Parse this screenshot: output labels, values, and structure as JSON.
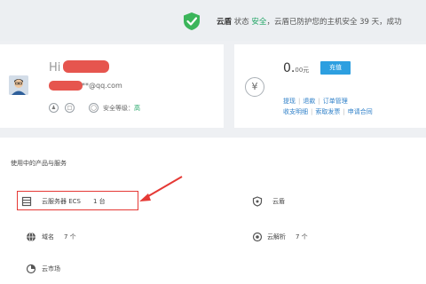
{
  "banner": {
    "brand": "云盾",
    "text_a": " 状态 ",
    "status": "安全",
    "text_b": "，云盾已防护您的主机安全 39 天，成功"
  },
  "user": {
    "greeting": "Hi",
    "email_suffix": "**@qq.com",
    "security_label": "安全等级：",
    "security_level": "高"
  },
  "account": {
    "balance_main": "0.",
    "balance_unit": "00元",
    "recharge_label": "充值",
    "links_row1": [
      "提现",
      "退款",
      "订单管理"
    ],
    "links_row2": [
      "收支明细",
      "索取发票",
      "申请合同"
    ]
  },
  "products": {
    "section_title": "使用中的产品与服务",
    "items": [
      {
        "label": "云服务器 ECS",
        "count": "1 台",
        "icon": "server-icon"
      },
      {
        "label": "云盾",
        "count": "",
        "icon": "shield-icon"
      },
      {
        "label": "域名",
        "count": "7 个",
        "icon": "globe-icon"
      },
      {
        "label": "云解析",
        "count": "7 个",
        "icon": "dns-icon"
      },
      {
        "label": "云市场",
        "count": "",
        "icon": "market-icon"
      }
    ]
  },
  "colors": {
    "accent": "#2d9fe0",
    "safe": "#1aa260",
    "annotation": "#e53935"
  }
}
